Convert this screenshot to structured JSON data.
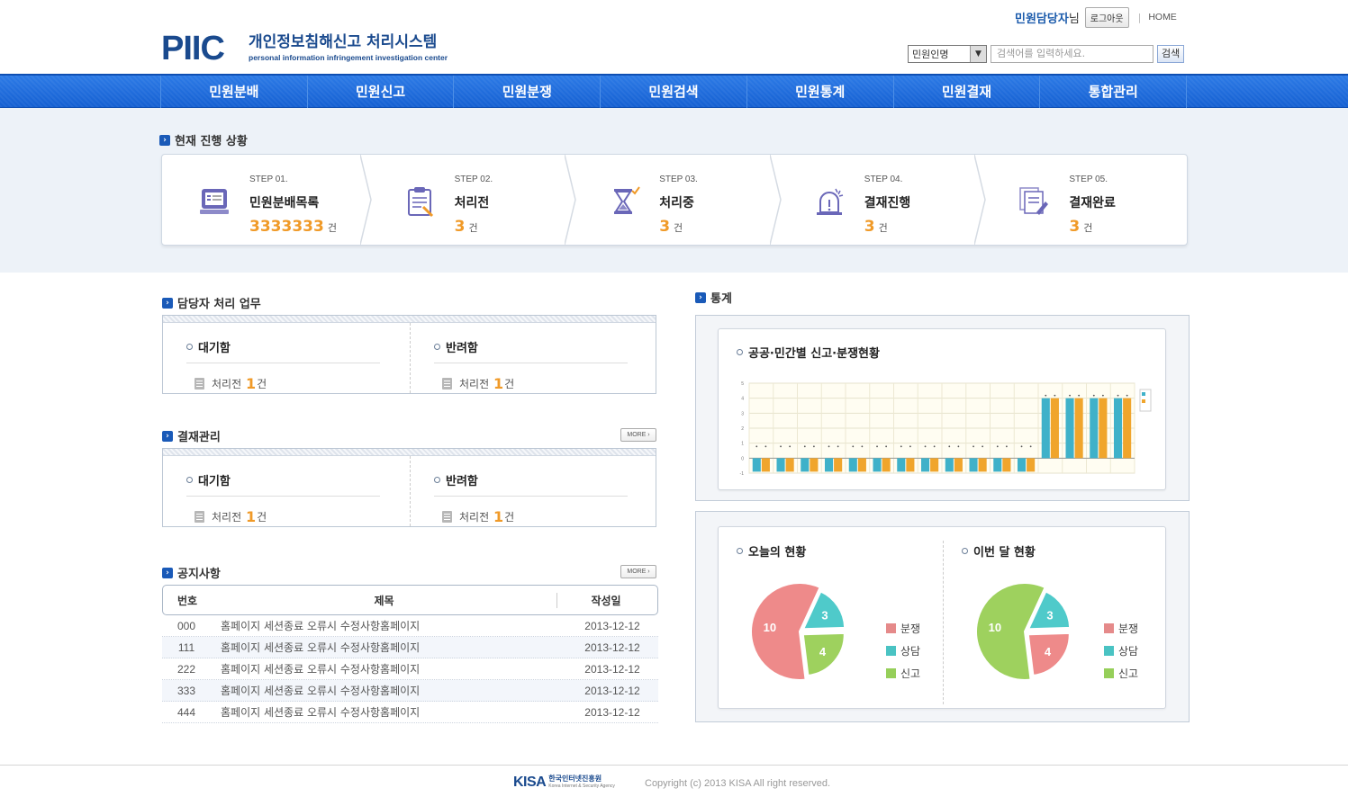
{
  "header": {
    "logo_mark": "PIIC",
    "logo_title": "개인정보침해신고 처리시스템",
    "logo_sub": "personal information infringement investigation center",
    "user_name": "민원담당자",
    "user_suffix": "님",
    "logout_label": "로그아웃",
    "home_label": "HOME",
    "search_select": "민원인명",
    "search_placeholder": "검색어를 입력하세요.",
    "search_button": "검색"
  },
  "nav": [
    "민원분배",
    "민원신고",
    "민원분쟁",
    "민원검색",
    "민원통계",
    "민원결재",
    "통합관리"
  ],
  "progress": {
    "title": "현재 진행 상황",
    "steps": [
      {
        "num": "STEP 01.",
        "name": "민원분배목록",
        "count": "3333333",
        "unit": "건"
      },
      {
        "num": "STEP 02.",
        "name": "처리전",
        "count": "3",
        "unit": "건"
      },
      {
        "num": "STEP 03.",
        "name": "처리중",
        "count": "3",
        "unit": "건"
      },
      {
        "num": "STEP 04.",
        "name": "결재진행",
        "count": "3",
        "unit": "건"
      },
      {
        "num": "STEP 05.",
        "name": "결재완료",
        "count": "3",
        "unit": "건"
      }
    ]
  },
  "tasks": {
    "title": "담당자 처리 업무",
    "left": {
      "title": "대기함",
      "item_prefix": "처리전",
      "item_count": "1",
      "item_unit": "건"
    },
    "right": {
      "title": "반려함",
      "item_prefix": "처리전",
      "item_count": "1",
      "item_unit": "건"
    }
  },
  "approval": {
    "title": "결재관리",
    "more": "MORE",
    "left": {
      "title": "대기함",
      "item_prefix": "처리전",
      "item_count": "1",
      "item_unit": "건"
    },
    "right": {
      "title": "반려함",
      "item_prefix": "처리전",
      "item_count": "1",
      "item_unit": "건"
    }
  },
  "notice": {
    "title": "공지사항",
    "more": "MORE",
    "headers": {
      "num": "번호",
      "title": "제목",
      "date": "작성일"
    },
    "rows": [
      {
        "num": "000",
        "title": "홈페이지 세션종료 오류시 수정사항홈페이지",
        "date": "2013-12-12"
      },
      {
        "num": "111",
        "title": "홈페이지 세션종료 오류시 수정사항홈페이지",
        "date": "2013-12-12"
      },
      {
        "num": "222",
        "title": "홈페이지 세션종료 오류시 수정사항홈페이지",
        "date": "2013-12-12"
      },
      {
        "num": "333",
        "title": "홈페이지 세션종료 오류시 수정사항홈페이지",
        "date": "2013-12-12"
      },
      {
        "num": "444",
        "title": "홈페이지 세션종료 오류시 수정사항홈페이지",
        "date": "2013-12-12"
      }
    ]
  },
  "stats": {
    "title": "통계",
    "bar_title": "공공·민간별 신고·분쟁현황",
    "today_title": "오늘의 현황",
    "month_title": "이번 달 현황",
    "legend": [
      {
        "label": "분쟁",
        "color": "#e58a8a"
      },
      {
        "label": "상담",
        "color": "#4ac3c3"
      },
      {
        "label": "신고",
        "color": "#96cf5a"
      }
    ]
  },
  "chart_data": [
    {
      "type": "bar",
      "ylim": [
        -1,
        5
      ],
      "series": [
        {
          "values": [
            0,
            0,
            0,
            0,
            0,
            0,
            0,
            0,
            0,
            0,
            0,
            0,
            4,
            4,
            4,
            4
          ],
          "color": "#3fb1c9"
        },
        {
          "values": [
            0,
            0,
            0,
            0,
            0,
            0,
            0,
            0,
            0,
            0,
            0,
            0,
            4,
            4,
            4,
            4
          ],
          "color": "#f0a52c"
        }
      ]
    },
    {
      "type": "pie",
      "title": "오늘의 현황",
      "slices": [
        {
          "label": "분쟁",
          "value": 10,
          "color": "#ee8a8a"
        },
        {
          "label": "상담",
          "value": 3,
          "color": "#4fcaca"
        },
        {
          "label": "신고",
          "value": 4,
          "color": "#9ed15e"
        }
      ]
    },
    {
      "type": "pie",
      "title": "이번 달 현황",
      "slices": [
        {
          "label": "신고",
          "value": 10,
          "color": "#9ed15e"
        },
        {
          "label": "상담",
          "value": 3,
          "color": "#4fcaca"
        },
        {
          "label": "분쟁",
          "value": 4,
          "color": "#ee8a8a"
        }
      ]
    }
  ],
  "footer": {
    "kisa_mark": "KISA",
    "kisa_name": "한국인터넷진흥원",
    "kisa_eng": "Korea Internet & Security Agency",
    "copyright": "Copyright (c) 2013 KISA All right reserved."
  }
}
